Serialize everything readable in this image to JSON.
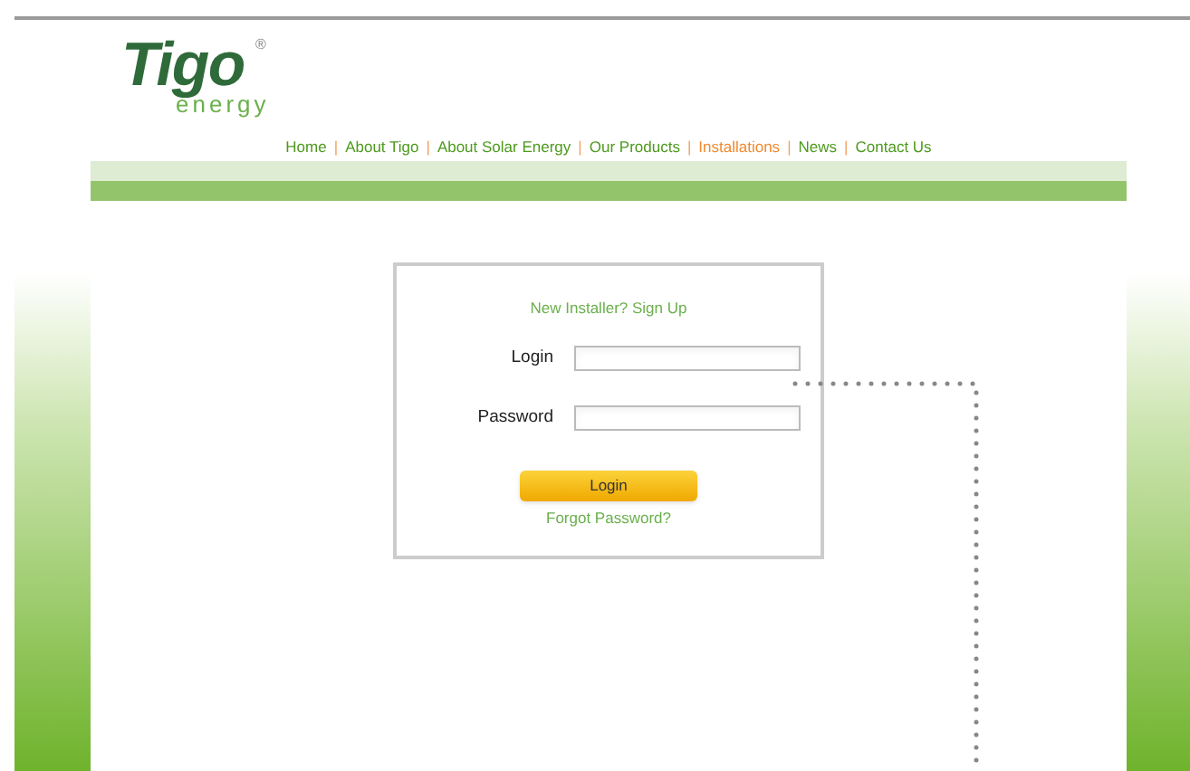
{
  "logo": {
    "name": "Tigo",
    "mark": "®",
    "tagline": "energy"
  },
  "nav": [
    {
      "label": "Home",
      "selected": false
    },
    {
      "label": "About Tigo",
      "selected": false
    },
    {
      "label": "About Solar Energy",
      "selected": false
    },
    {
      "label": "Our Products",
      "selected": false
    },
    {
      "label": "Installations",
      "selected": true
    },
    {
      "label": "News",
      "selected": false
    },
    {
      "label": "Contact Us",
      "selected": false
    }
  ],
  "separator": "|",
  "login_form": {
    "signup_link": "New Installer? Sign Up",
    "fields": [
      {
        "label": "Login"
      },
      {
        "label": "Password"
      }
    ],
    "submit": "Login",
    "forgot_link": "Forgot Password?"
  }
}
